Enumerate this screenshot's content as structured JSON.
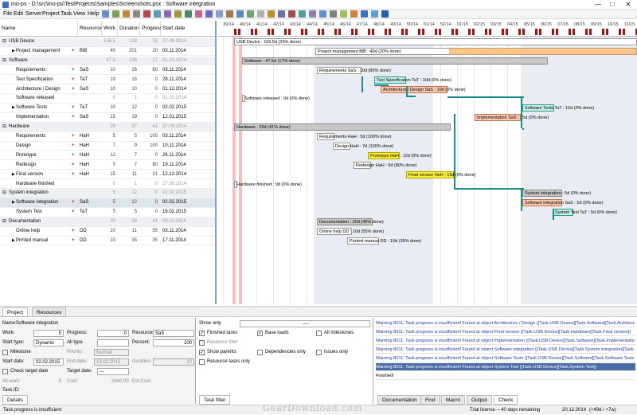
{
  "window": {
    "title": "mo-ps - D:\\src\\mo-ps\\TestProjects\\Samples\\Screenshots.psx : Software integration",
    "minimize": "—",
    "maximize": "□",
    "close": "✕"
  },
  "menu": [
    "File",
    "Edit",
    "Server",
    "Project",
    "Task",
    "View",
    "Help"
  ],
  "grid": {
    "headers": {
      "name": "Name",
      "resource": "Resource",
      "work": "Work",
      "duration": "Duration",
      "progress": "Progress",
      "start": "Start date"
    },
    "rows": [
      {
        "name": "USB Device",
        "resource": "",
        "work": "156.5",
        "duration": "128",
        "progress": "26",
        "start": "27.09.2014",
        "kind": "summary"
      },
      {
        "name": "Project management",
        "resource": "BiB",
        "work": "40",
        "duration": "201",
        "progress": "20",
        "start": "03.11.2014",
        "kind": "task"
      },
      {
        "name": "Software",
        "resource": "",
        "work": "47.5",
        "duration": "136",
        "progress": "17",
        "start": "01.10.2014",
        "kind": "summary"
      },
      {
        "name": "Requirements",
        "resource": "SaS",
        "work": "10",
        "duration": "26",
        "progress": "80",
        "start": "03.11.2014",
        "kind": "task"
      },
      {
        "name": "Test Specification",
        "resource": "TaT",
        "work": "10",
        "duration": "15",
        "progress": "0",
        "start": "28.11.2014",
        "kind": "task"
      },
      {
        "name": "Architecture / Design",
        "resource": "SaS",
        "work": "10",
        "duration": "10",
        "progress": "0",
        "start": "01.12.2014",
        "kind": "task"
      },
      {
        "name": "Software released",
        "resource": "",
        "work": "0",
        "duration": "1",
        "progress": "0",
        "start": "01.10.2014",
        "kind": "milestone"
      },
      {
        "name": "Software Tests",
        "resource": "TaT",
        "work": "10",
        "duration": "12",
        "progress": "0",
        "start": "02.02.2015",
        "kind": "task"
      },
      {
        "name": "Implementation",
        "resource": "SaS",
        "work": "15",
        "duration": "19",
        "progress": "0",
        "start": "12.01.2015",
        "kind": "task"
      },
      {
        "name": "Hardware",
        "resource": "",
        "work": "39",
        "duration": "97",
        "progress": "41",
        "start": "27.09.2014",
        "kind": "summary"
      },
      {
        "name": "Requirements",
        "resource": "HaH",
        "work": "5",
        "duration": "5",
        "progress": "100",
        "start": "03.11.2014",
        "kind": "task"
      },
      {
        "name": "Design",
        "resource": "HaH",
        "work": "7",
        "duration": "9",
        "progress": "100",
        "start": "10.11.2014",
        "kind": "task"
      },
      {
        "name": "Prototype",
        "resource": "HaH",
        "work": "12",
        "duration": "7",
        "progress": "0",
        "start": "26.11.2014",
        "kind": "task"
      },
      {
        "name": "Redesign",
        "resource": "HaH",
        "work": "5",
        "duration": "7",
        "progress": "80",
        "start": "19.11.2014",
        "kind": "task"
      },
      {
        "name": "Final version",
        "resource": "HaH",
        "work": "15",
        "duration": "11",
        "progress": "21",
        "start": "12.12.2014",
        "kind": "task"
      },
      {
        "name": "Hardware finished",
        "resource": "",
        "work": "0",
        "duration": "1",
        "progress": "0",
        "start": "27.09.2014",
        "kind": "milestone"
      },
      {
        "name": "System integration",
        "resource": "",
        "work": "5",
        "duration": "12",
        "progress": "0",
        "start": "02.02.2015",
        "kind": "summary"
      },
      {
        "name": "Software integration",
        "resource": "SaS",
        "work": "5",
        "duration": "12",
        "progress": "0",
        "start": "02.02.2015",
        "kind": "selected"
      },
      {
        "name": "System Test",
        "resource": "TaT",
        "work": "5",
        "duration": "5",
        "progress": "0",
        "start": "16.02.2015",
        "kind": "task"
      },
      {
        "name": "Documentation",
        "resource": "",
        "work": "20",
        "duration": "26",
        "progress": "41",
        "start": "03.11.2014",
        "kind": "summary"
      },
      {
        "name": "Online help",
        "resource": "DD",
        "work": "10",
        "duration": "11",
        "progress": "55",
        "start": "03.11.2014",
        "kind": "task"
      },
      {
        "name": "Printed manual",
        "resource": "DD",
        "work": "10",
        "duration": "35",
        "progress": "35",
        "start": "17.11.2014",
        "kind": "task"
      }
    ]
  },
  "gantt": {
    "weeks": [
      "39/14",
      "40/14",
      "41/14",
      "42/14",
      "43/14",
      "44/14",
      "45/14",
      "46/14",
      "47/14",
      "48/14",
      "49/14",
      "50/14",
      "51/14",
      "52/14",
      "01/15",
      "02/15",
      "03/15",
      "04/15",
      "05/15",
      "06/15",
      "07/15",
      "08/15",
      "09/15",
      "10/15",
      "11/15"
    ],
    "bars": [
      {
        "label": "USB Device : 156.5d (26% done)"
      },
      {
        "label": "Project management BiB : 40d (20% done)"
      },
      {
        "label": "Software : 47.5d (17% done)"
      },
      {
        "label": "Requirements SaS : 10d (80% done)"
      },
      {
        "label": "Test Specification TaT : 10d (0% done)"
      },
      {
        "label": "Architecture / Design SaS : 10d (0% done)"
      },
      {
        "label": "Software released : 0d (0% done)"
      },
      {
        "label": "Software Tests TaT : 10d (0% done)"
      },
      {
        "label": "Implementation SaS : 15d (0% done)"
      },
      {
        "label": "Hardware : 39d (41% done)"
      },
      {
        "label": "Requirements HaH : 5d (100% done)"
      },
      {
        "label": "Design HaH : 7d (100% done)"
      },
      {
        "label": "Prototype HaH : 12d (0% done)"
      },
      {
        "label": "Redesign HaH : 5d (80% done)"
      },
      {
        "label": "Final version HaH : 15d (0% done)"
      },
      {
        "label": "Hardware finished : 0d (0% done)"
      },
      {
        "label": "System integration : 5d (0% done)"
      },
      {
        "label": "Software integration SaS : 5d (0% done)"
      },
      {
        "label": "System Test TaT : 5d (0% done)"
      },
      {
        "label": "Documentation : 20d (45% done)"
      },
      {
        "label": "Online help DD : 10d (55% done)"
      },
      {
        "label": "Printed manual DD : 10d (35% done)"
      }
    ]
  },
  "tabs": {
    "project": "Project",
    "resources": "Resources"
  },
  "details": {
    "name_label": "Name:",
    "name_value": "Software integration",
    "work_label": "Work:",
    "work_value": "5",
    "progress_label": "Progress:",
    "progress_value": "0",
    "resource_label": "Resource:",
    "resource_value": "SaS",
    "starttype_label": "Start type:",
    "starttype_value": "Dynamic",
    "alltype_label": "All type",
    "percent_label": "Percent:",
    "percent_value": "100",
    "milestone_label": "Milestone",
    "priority_label": "Priority:",
    "priority_value": "Normal",
    "startdate_label": "Start date:",
    "startdate_value": "02.02.2015",
    "enddate_label": "End date:",
    "enddate_value": "13.02.2015",
    "duration_label": "Duration:",
    "duration_value": "12",
    "checktarget_label": "Check target date",
    "targetdate_label": "Target date:",
    "targetdate_value": "---",
    "allwork_label": "All work:",
    "allwork_value": "5",
    "cost_label": "Cost:",
    "cost_value": "2640.00",
    "estcost_label": "Est.Cost:",
    "taskid_label": "Task ID:",
    "tab": "Details"
  },
  "filter": {
    "show_only": "Show only",
    "show_only_value": "----",
    "finished": "Finished tasks",
    "baseloads": "Base loads",
    "allmilestones": "All milestones",
    "resfilter": "Resource filter",
    "showparents": "Show parents",
    "deponly": "Dependencies only",
    "issuesonly": "Issues only",
    "restasks": "Resource tasks only",
    "tab": "Task filter"
  },
  "messages": [
    "Warning 8011: Task progress is insufficient! Found at object Architecture / Design ([Task.USB Device][Task.Software][Task.Architect",
    "Warning 8011: Task progress is insufficient! Found at object Final version ([Task.USB Device][Task.Hardware][Task.Final version])",
    "Warning 8011: Task progress is insufficient! Found at object Implementation ([Task.USB Device][Task.Software][Task.Implementatio",
    "Warning 8011: Task progress is insufficient! Found at object Software integration ([Task.USB Device][Task.System integration][Task.",
    "Warning 8011: Task progress is insufficient! Found at object Software Tests ([Task.USB Device][Task.Software][Task.Software Tests",
    "Warning 8011: Task progress is insufficient! Found at object System Test ([Task.USB Device][Task.System Test])",
    "Finished!"
  ],
  "bottom_tabs": [
    "Documentation",
    "Find",
    "Macro",
    "Output",
    "Check"
  ],
  "status": {
    "left": "Task progress is insufficient",
    "license": "Trial license -- 40 days remaining",
    "date": "20.12.2014",
    "stats": "(<49d / +7w)"
  },
  "watermark": "GearDownload.com",
  "colors": {
    "summary": "#c8c8c8",
    "yellow": "#ffee33",
    "teal": "#2a9a8a",
    "salmon": "#f7c9b0",
    "selection": "#4a6aa8"
  }
}
